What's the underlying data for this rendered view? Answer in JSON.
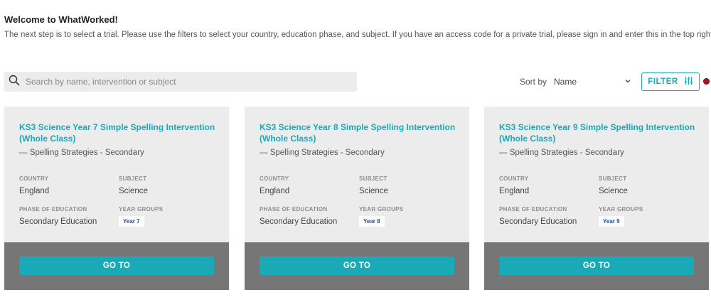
{
  "header": {
    "title": "Welcome to WhatWorked!",
    "description": "The next step is to select a trial. Please use the filters to select your country, education phase, and subject. If you have an access code for a private trial, please sign in and enter this in the top right box."
  },
  "search": {
    "placeholder": "Search by name, intervention or subject",
    "value": ""
  },
  "sort": {
    "label": "Sort by",
    "selected": "Name"
  },
  "filter": {
    "label": "FILTER"
  },
  "colors": {
    "accent": "#1aa9b7",
    "card_bg": "#ececec",
    "footer_bg": "#767676",
    "status_dot": "#b0141b"
  },
  "cards": [
    {
      "title": "KS3 Science Year 7 Simple Spelling Intervention (Whole Class)",
      "subtitle": "— Spelling Strategies - Secondary",
      "country_label": "COUNTRY",
      "country": "England",
      "subject_label": "SUBJECT",
      "subject": "Science",
      "phase_label": "PHASE OF EDUCATION",
      "phase": "Secondary Education",
      "year_groups_label": "YEAR GROUPS",
      "year_group": "Year 7",
      "button": "GO TO"
    },
    {
      "title": "KS3 Science Year 8 Simple Spelling Intervention (Whole Class)",
      "subtitle": "— Spelling Strategies - Secondary",
      "country_label": "COUNTRY",
      "country": "England",
      "subject_label": "SUBJECT",
      "subject": "Science",
      "phase_label": "PHASE OF EDUCATION",
      "phase": "Secondary Education",
      "year_groups_label": "YEAR GROUPS",
      "year_group": "Year 8",
      "button": "GO TO"
    },
    {
      "title": "KS3 Science Year 9 Simple Spelling Intervention (Whole Class)",
      "subtitle": "— Spelling Strategies - Secondary",
      "country_label": "COUNTRY",
      "country": "England",
      "subject_label": "SUBJECT",
      "subject": "Science",
      "phase_label": "PHASE OF EDUCATION",
      "phase": "Secondary Education",
      "year_groups_label": "YEAR GROUPS",
      "year_group": "Year 9",
      "button": "GO TO"
    }
  ]
}
